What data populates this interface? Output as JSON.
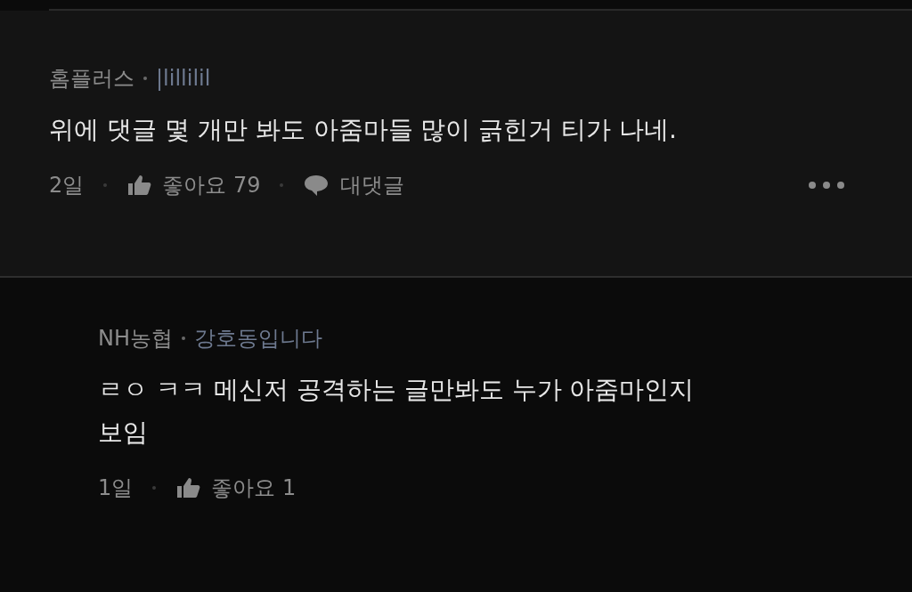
{
  "comments": [
    {
      "author": "홈플러스",
      "nickname": "|lillilil",
      "text": "위에 댓글 몇 개만 봐도 아줌마들 많이 긁힌거 티가 나네.",
      "time": "2일",
      "likes": "좋아요 79",
      "reply_label": "대댓글",
      "menu": true,
      "nested": false
    },
    {
      "author": "NH농협",
      "nickname": "강호동입니다",
      "text": "ㄹㅇ ㅋㅋ 메신저 공격하는 글만봐도 누가 아줌마인지 보임",
      "time": "1일",
      "likes": "좋아요 1",
      "menu": false,
      "nested": true
    }
  ]
}
